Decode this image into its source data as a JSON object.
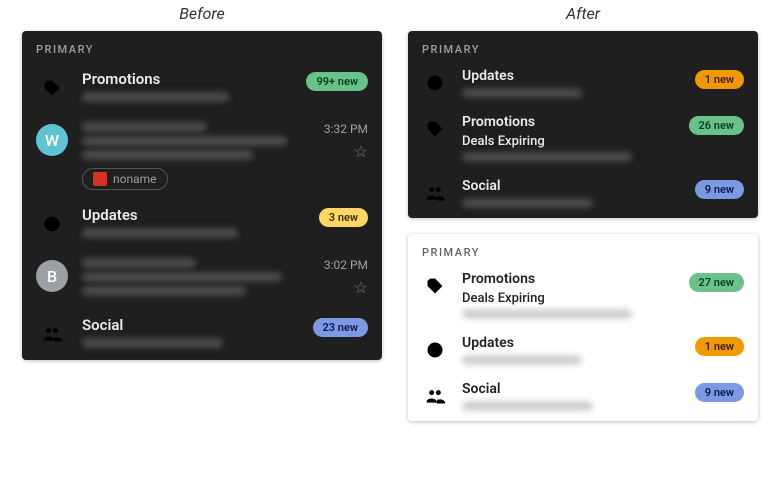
{
  "labels": {
    "before": "Before",
    "after": "After"
  },
  "primary": "PRIMARY",
  "before_panel": {
    "rows": [
      {
        "kind": "category",
        "icon": "tag-green",
        "title": "Promotions",
        "badge": "99+ new",
        "badge_class": "badge-green"
      },
      {
        "kind": "email",
        "avatar": "W",
        "avatar_color": "#5fc3d1",
        "time": "3:32 PM",
        "has_star": true,
        "attachment": "noname"
      },
      {
        "kind": "category",
        "icon": "info-yellow",
        "title": "Updates",
        "badge": "3 new",
        "badge_class": "badge-yellow"
      },
      {
        "kind": "email",
        "avatar": "B",
        "avatar_color": "#9aa0a6",
        "time": "3:02 PM",
        "has_star": true
      },
      {
        "kind": "category",
        "icon": "people-blue",
        "title": "Social",
        "badge": "23 new",
        "badge_class": "badge-blue"
      }
    ]
  },
  "after_dark": {
    "rows": [
      {
        "icon": "info-orange",
        "title": "Updates",
        "badge": "1 new",
        "badge_class": "badge-orange"
      },
      {
        "icon": "tag-green",
        "title": "Promotions",
        "sub": "Deals Expiring",
        "badge": "26 new",
        "badge_class": "badge-green"
      },
      {
        "icon": "people-blue",
        "title": "Social",
        "badge": "9 new",
        "badge_class": "badge-blue"
      }
    ]
  },
  "after_light": {
    "rows": [
      {
        "icon": "tag-green",
        "title": "Promotions",
        "sub": "Deals Expiring",
        "badge": "27 new",
        "badge_class": "badge-green"
      },
      {
        "icon": "info-orange",
        "title": "Updates",
        "badge": "1 new",
        "badge_class": "badge-orange"
      },
      {
        "icon": "people-blue",
        "title": "Social",
        "badge": "9 new",
        "badge_class": "badge-blue"
      }
    ]
  }
}
